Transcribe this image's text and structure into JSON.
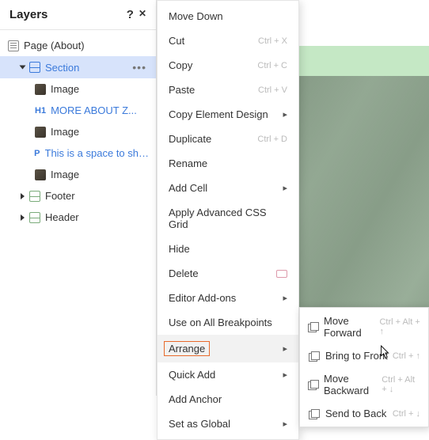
{
  "panel": {
    "title": "Layers",
    "help": "?",
    "close": "✕"
  },
  "tree": {
    "page": "Page (About)",
    "section": "Section",
    "image1": "Image",
    "h1_badge": "H1",
    "h1_text": "MORE ABOUT Z...",
    "image2": "Image",
    "p_badge": "P",
    "p_text": "This is a space to sha...",
    "image3": "Image",
    "footer": "Footer",
    "header": "Header",
    "dots": "•••"
  },
  "menu": {
    "move_down": "Move Down",
    "cut": "Cut",
    "cut_sc": "Ctrl + X",
    "copy": "Copy",
    "copy_sc": "Ctrl + C",
    "paste": "Paste",
    "paste_sc": "Ctrl + V",
    "copy_design": "Copy Element Design",
    "duplicate": "Duplicate",
    "dup_sc": "Ctrl + D",
    "rename": "Rename",
    "add_cell": "Add Cell",
    "apply_grid": "Apply Advanced CSS Grid",
    "hide": "Hide",
    "delete": "Delete",
    "addons": "Editor Add-ons",
    "breakpoints": "Use on All Breakpoints",
    "arrange": "Arrange",
    "quick_add": "Quick Add",
    "add_anchor": "Add Anchor",
    "set_global": "Set as Global"
  },
  "submenu": {
    "forward": "Move Forward",
    "forward_sc": "Ctrl + Alt + ↑",
    "front": "Bring to Front",
    "front_sc": "Ctrl + ↑",
    "backward": "Move Backward",
    "backward_sc": "Ctrl + Alt + ↓",
    "back": "Send to Back",
    "back_sc": "Ctrl + ↓"
  }
}
